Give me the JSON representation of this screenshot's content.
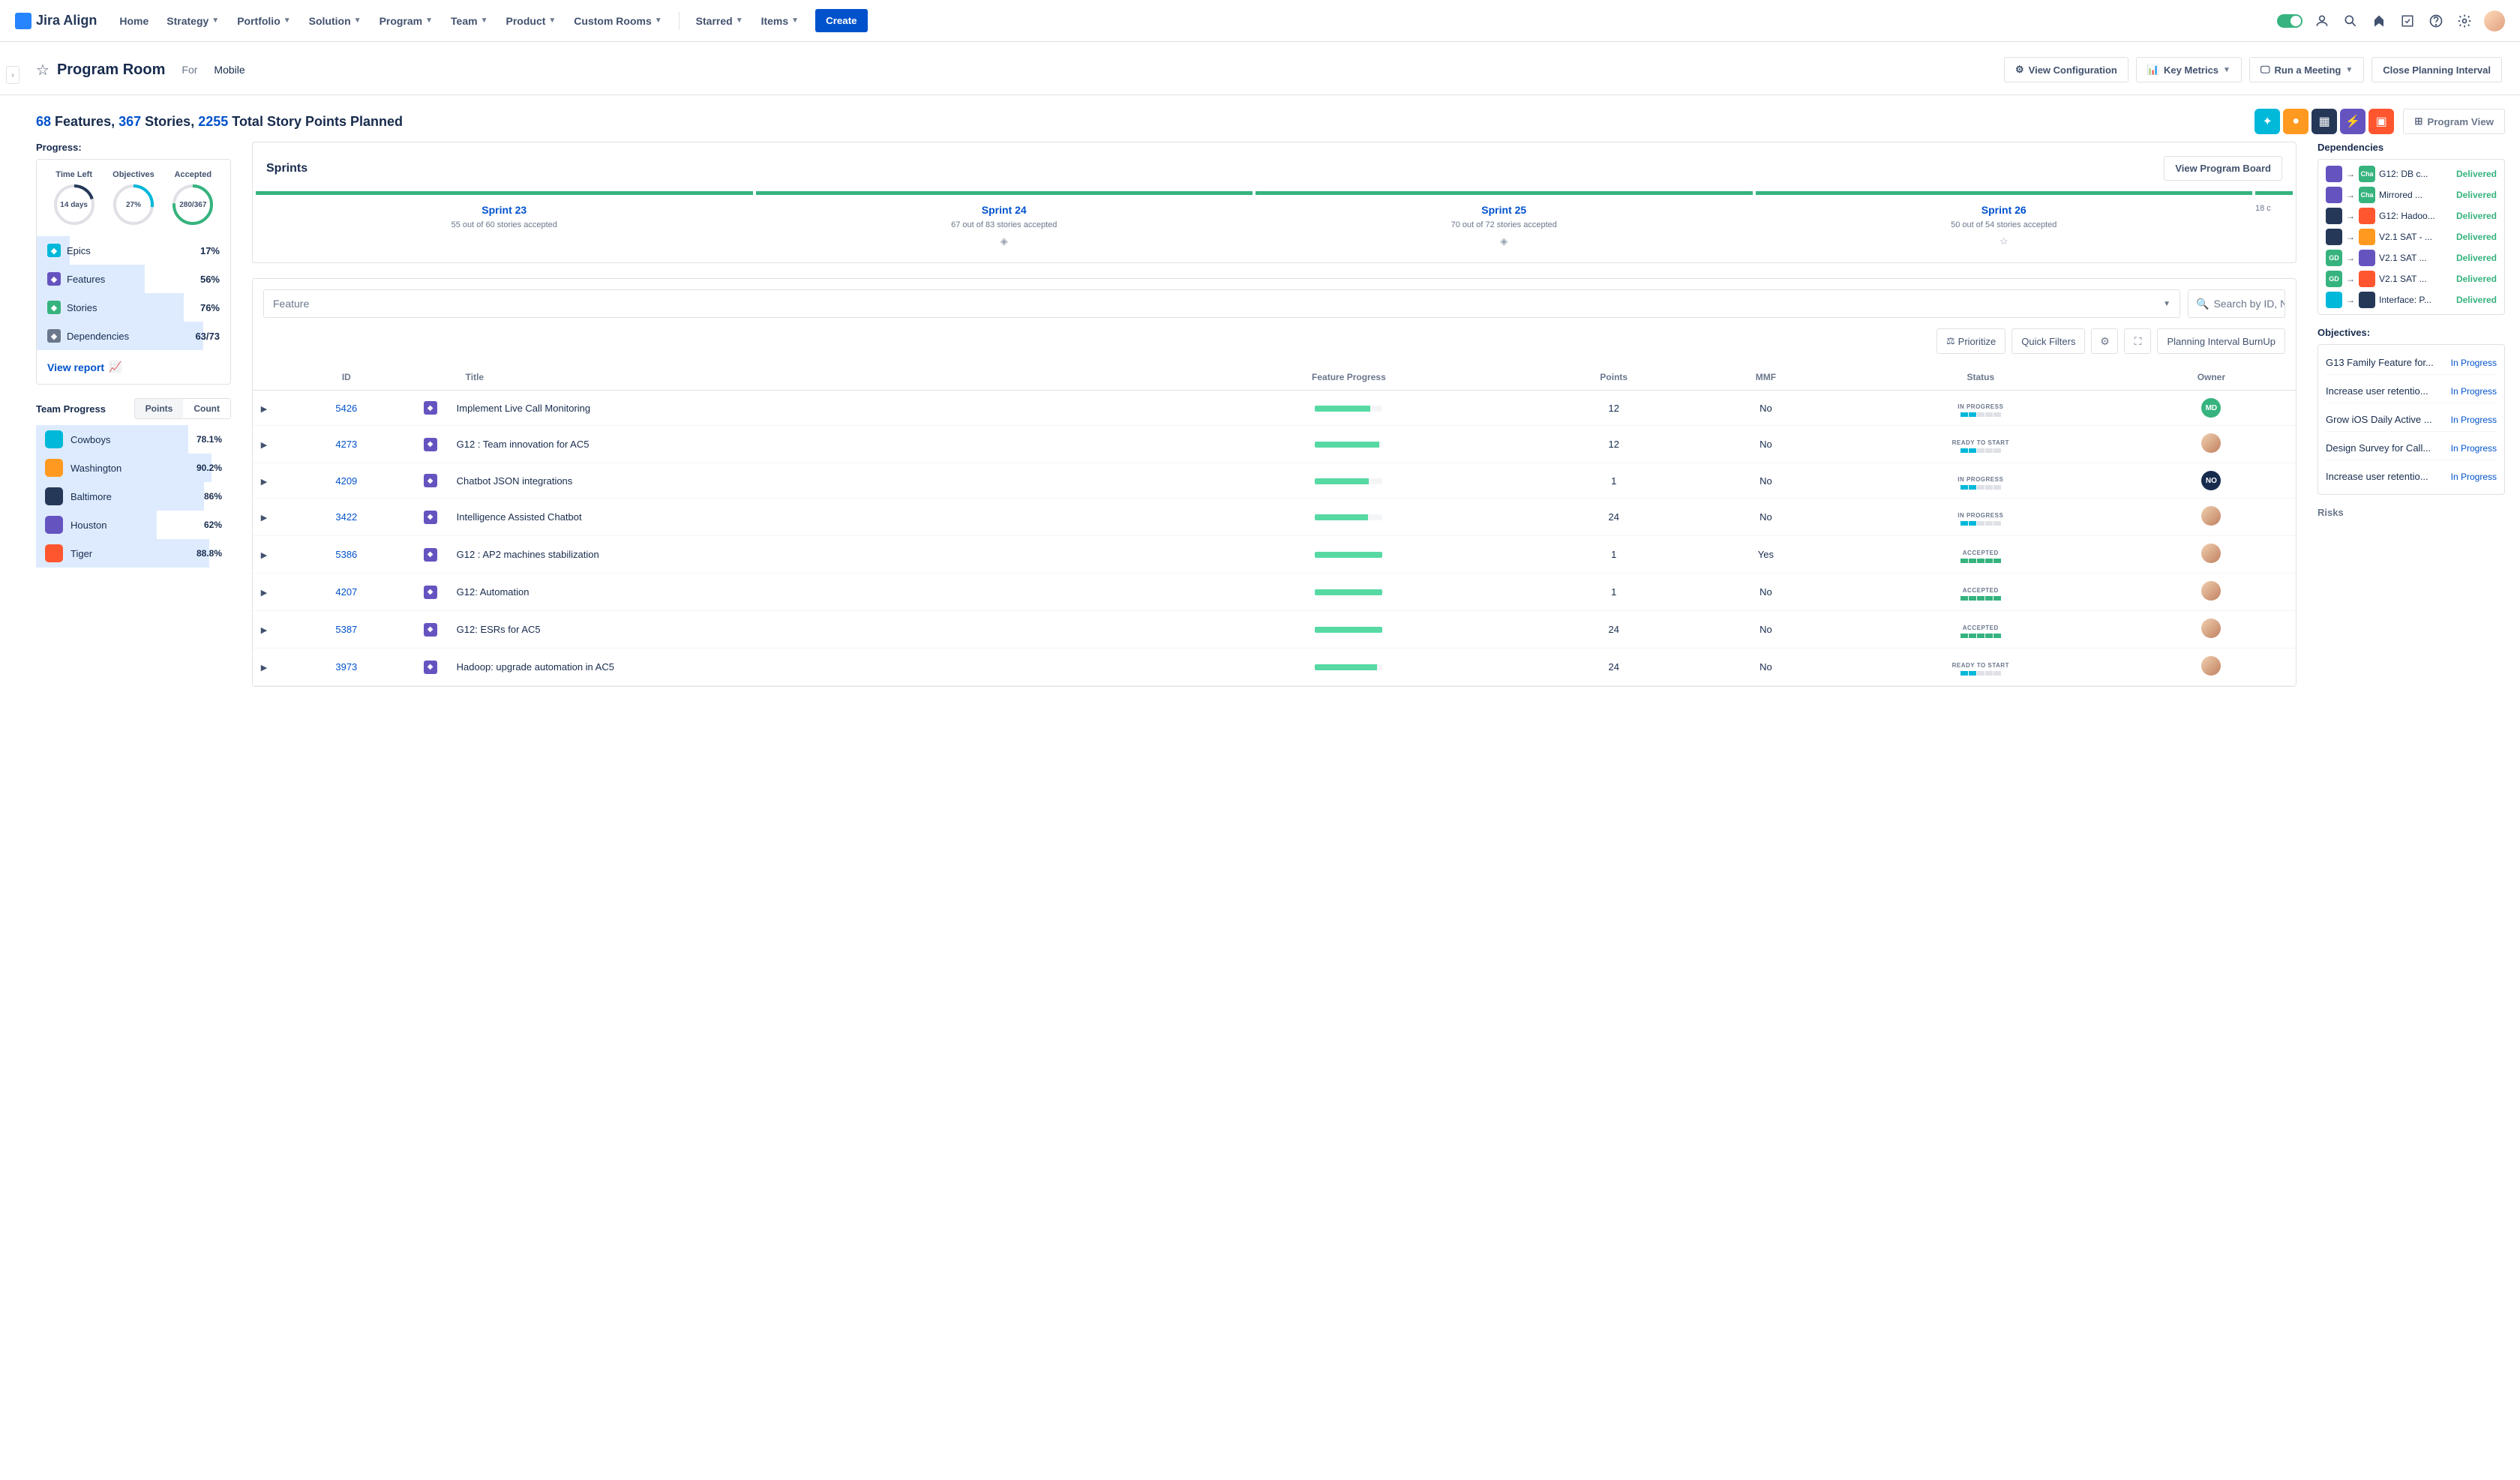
{
  "app": {
    "name": "Jira Align"
  },
  "nav": {
    "items": [
      "Home",
      "Strategy",
      "Portfolio",
      "Solution",
      "Program",
      "Team",
      "Product",
      "Custom Rooms"
    ],
    "right_items": [
      "Starred",
      "Items"
    ],
    "create": "Create"
  },
  "header": {
    "title": "Program Room",
    "for_label": "For",
    "for_value": "Mobile",
    "buttons": {
      "view_config": "View Configuration",
      "key_metrics": "Key Metrics",
      "run_meeting": "Run a Meeting",
      "close_interval": "Close Planning Interval"
    }
  },
  "summary": {
    "features_n": "68",
    "features_l": "Features,",
    "stories_n": "367",
    "stories_l": "Stories,",
    "points_n": "2255",
    "points_l": "Total Story Points Planned",
    "program_view": "Program View"
  },
  "progress": {
    "label": "Progress:",
    "rings": [
      {
        "label": "Time Left",
        "value": "14 days",
        "pct": 20,
        "color": "#253858"
      },
      {
        "label": "Objectives",
        "value": "27%",
        "pct": 27,
        "color": "#00B8D9"
      },
      {
        "label": "Accepted",
        "value": "280/367",
        "pct": 76,
        "color": "#36B37E"
      }
    ],
    "bars": [
      {
        "icon": "#00B8D9",
        "name": "Epics",
        "val": "17%",
        "w": 17
      },
      {
        "icon": "#6554C0",
        "name": "Features",
        "val": "56%",
        "w": 56
      },
      {
        "icon": "#36B37E",
        "name": "Stories",
        "val": "76%",
        "w": 76
      },
      {
        "icon": "#6B778C",
        "name": "Dependencies",
        "val": "63/73",
        "w": 86
      }
    ],
    "view_report": "View report"
  },
  "team_progress": {
    "label": "Team Progress",
    "tabs": {
      "points": "Points",
      "count": "Count"
    },
    "rows": [
      {
        "name": "Cowboys",
        "val": "78.1%",
        "w": 78,
        "color": "#00B8D9"
      },
      {
        "name": "Washington",
        "val": "90.2%",
        "w": 90,
        "color": "#FF991F"
      },
      {
        "name": "Baltimore",
        "val": "86%",
        "w": 86,
        "color": "#253858"
      },
      {
        "name": "Houston",
        "val": "62%",
        "w": 62,
        "color": "#6554C0"
      },
      {
        "name": "Tiger",
        "val": "88.8%",
        "w": 89,
        "color": "#FF5630"
      }
    ]
  },
  "sprints": {
    "title": "Sprints",
    "view_board": "View Program Board",
    "cols": [
      {
        "name": "Sprint 23",
        "sub": "55 out of 60 stories accepted",
        "mark": ""
      },
      {
        "name": "Sprint 24",
        "sub": "67 out of 83 stories accepted",
        "mark": "◈"
      },
      {
        "name": "Sprint 25",
        "sub": "70 out of 72 stories accepted",
        "mark": "◈"
      },
      {
        "name": "Sprint 26",
        "sub": "50 out of 54 stories accepted",
        "mark": "☆"
      }
    ],
    "tail": "18 c"
  },
  "table": {
    "dd": "Feature",
    "search_ph": "Search by ID, Nar",
    "prioritize": "Prioritize",
    "quick_filters": "Quick Filters",
    "burnup": "Planning Interval BurnUp",
    "cols": {
      "id": "ID",
      "title": "Title",
      "fp": "Feature Progress",
      "points": "Points",
      "mmf": "MMF",
      "status": "Status",
      "owner": "Owner"
    },
    "rows": [
      {
        "id": "5426",
        "title": "Implement Live Call Monitoring",
        "prog": 82,
        "points": "12",
        "mmf": "No",
        "status": "IN PROGRESS",
        "st": "b",
        "owner": "MD",
        "ocolor": "#36B37E"
      },
      {
        "id": "4273",
        "title": "G12 : Team innovation for AC5",
        "prog": 95,
        "points": "12",
        "mmf": "No",
        "status": "READY TO START",
        "st": "b",
        "owner": "",
        "ocolor": ""
      },
      {
        "id": "4209",
        "title": "Chatbot JSON integrations",
        "prog": 80,
        "points": "1",
        "mmf": "No",
        "status": "IN PROGRESS",
        "st": "b",
        "owner": "NO",
        "ocolor": "#172B4D"
      },
      {
        "id": "3422",
        "title": "Intelligence Assisted Chatbot",
        "prog": 78,
        "points": "24",
        "mmf": "No",
        "status": "IN PROGRESS",
        "st": "b",
        "owner": "",
        "ocolor": ""
      },
      {
        "id": "5386",
        "title": "G12 : AP2 machines stabilization",
        "prog": 100,
        "points": "1",
        "mmf": "Yes",
        "status": "ACCEPTED",
        "st": "g",
        "owner": "",
        "ocolor": ""
      },
      {
        "id": "4207",
        "title": "G12: Automation",
        "prog": 100,
        "points": "1",
        "mmf": "No",
        "status": "ACCEPTED",
        "st": "g",
        "owner": "",
        "ocolor": ""
      },
      {
        "id": "5387",
        "title": "G12: ESRs for AC5",
        "prog": 100,
        "points": "24",
        "mmf": "No",
        "status": "ACCEPTED",
        "st": "g",
        "owner": "",
        "ocolor": ""
      },
      {
        "id": "3973",
        "title": "Hadoop: upgrade automation in AC5",
        "prog": 92,
        "points": "24",
        "mmf": "No",
        "status": "READY TO START",
        "st": "b",
        "owner": "",
        "ocolor": ""
      }
    ]
  },
  "dependencies": {
    "label": "Dependencies",
    "rows": [
      {
        "c1": "#6554C0",
        "c2": "#36B37E",
        "t2": "Cha",
        "name": "G12: DB c...",
        "status": "Delivered"
      },
      {
        "c1": "#6554C0",
        "c2": "#36B37E",
        "t2": "Cha",
        "name": "Mirrored ...",
        "status": "Delivered"
      },
      {
        "c1": "#253858",
        "c2": "#FF5630",
        "name": "G12: Hadoo...",
        "status": "Delivered"
      },
      {
        "c1": "#253858",
        "c2": "#FF991F",
        "name": "V2.1 SAT - ...",
        "status": "Delivered"
      },
      {
        "c1": "#36B37E",
        "t1": "GD",
        "c2": "#6554C0",
        "name": "V2.1 SAT ...",
        "status": "Delivered"
      },
      {
        "c1": "#36B37E",
        "t1": "GD",
        "c2": "#FF5630",
        "name": "V2.1 SAT ...",
        "status": "Delivered"
      },
      {
        "c1": "#00B8D9",
        "c2": "#253858",
        "name": "Interface: P...",
        "status": "Delivered"
      }
    ]
  },
  "objectives": {
    "label": "Objectives:",
    "rows": [
      {
        "name": "G13 Family Feature for...",
        "status": "In Progress"
      },
      {
        "name": "Increase user retentio...",
        "status": "In Progress"
      },
      {
        "name": "Grow iOS Daily Active ...",
        "status": "In Progress"
      },
      {
        "name": "Design Survey for Call...",
        "status": "In Progress"
      },
      {
        "name": "Increase user retentio...",
        "status": "In Progress"
      }
    ]
  },
  "risks_label": "Risks"
}
